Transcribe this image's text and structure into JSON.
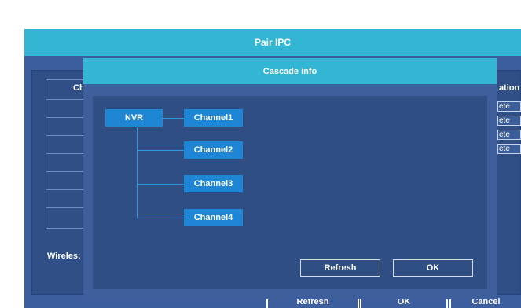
{
  "outer_dialog": {
    "title": "Pair IPC",
    "columns": {
      "channel_partial": "Ch",
      "operation_partial": "ation"
    },
    "delete_buttons": [
      "ete",
      "ete",
      "ete",
      "ete"
    ],
    "wireless_label": "Wireles:",
    "buttons": {
      "refresh": "Refresh",
      "ok": "OK",
      "cancel": "Cancel"
    }
  },
  "cascade_dialog": {
    "title": "Cascade info",
    "root": "NVR",
    "channels": [
      "Channel1",
      "Channel2",
      "Channel3",
      "Channel4"
    ],
    "buttons": {
      "refresh": "Refresh",
      "ok": "OK"
    }
  },
  "colors": {
    "title_bar": "#33b6d3",
    "panel": "#2e4e84",
    "node": "#1e86d4"
  }
}
